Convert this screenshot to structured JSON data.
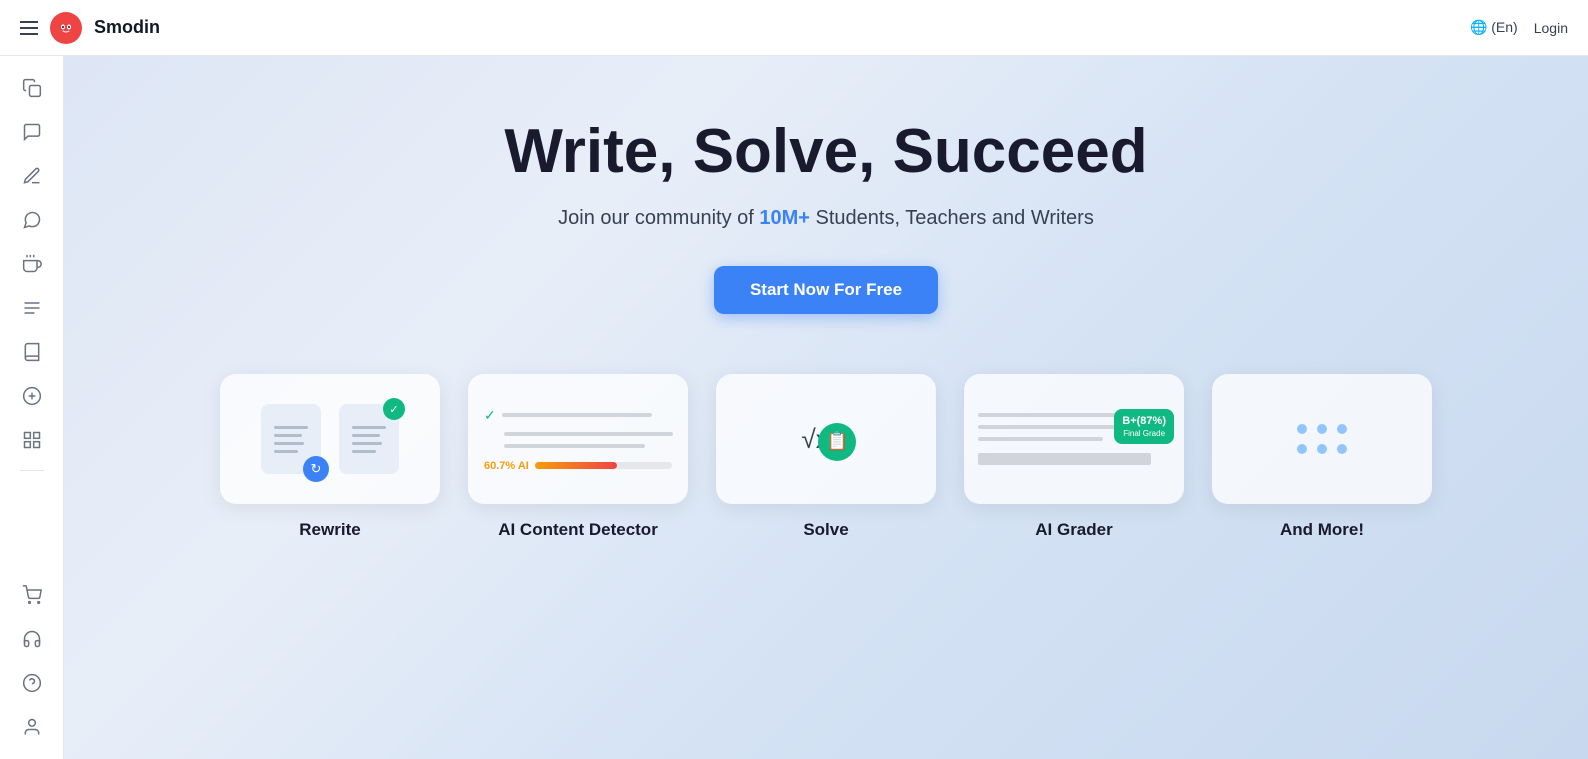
{
  "header": {
    "menu_icon": "☰",
    "logo_icon": "🦉",
    "logo_text": "Smodin",
    "lang_label": "🌐 (En)",
    "login_label": "Login"
  },
  "sidebar": {
    "icons": [
      {
        "name": "copy-icon",
        "glyph": "⧉"
      },
      {
        "name": "chat-bubble-icon",
        "glyph": "💬"
      },
      {
        "name": "pencil-icon",
        "glyph": "✏️"
      },
      {
        "name": "message-icon",
        "glyph": "🗨"
      },
      {
        "name": "hand-icon",
        "glyph": "🤚"
      },
      {
        "name": "lines-icon",
        "glyph": "≡"
      },
      {
        "name": "book-icon",
        "glyph": "📚"
      },
      {
        "name": "text-icon",
        "glyph": "A"
      },
      {
        "name": "grid-icon",
        "glyph": "⊞"
      }
    ],
    "bottom_icons": [
      {
        "name": "cart-icon",
        "glyph": "🛒"
      },
      {
        "name": "headset-icon",
        "glyph": "🎧"
      },
      {
        "name": "help-icon",
        "glyph": "?"
      },
      {
        "name": "user-icon",
        "glyph": "👤"
      }
    ]
  },
  "hero": {
    "title_part1": "Write, Solve, ",
    "title_bold": "Succeed",
    "subtitle_prefix": "Join our community of ",
    "subtitle_highlight": "10M+",
    "subtitle_suffix": " Students, Teachers and Writers",
    "cta_label": "Start Now For Free"
  },
  "features": [
    {
      "id": "rewrite",
      "label": "Rewrite"
    },
    {
      "id": "detector",
      "label": "AI Content Detector",
      "ai_percent": "60.7% AI"
    },
    {
      "id": "solve",
      "label": "Solve",
      "math": "√x  ?"
    },
    {
      "id": "grader",
      "label": "AI Grader",
      "grade": "B+(87%)",
      "grade_sub": "Final Grade"
    },
    {
      "id": "more",
      "label": "And More!"
    }
  ]
}
